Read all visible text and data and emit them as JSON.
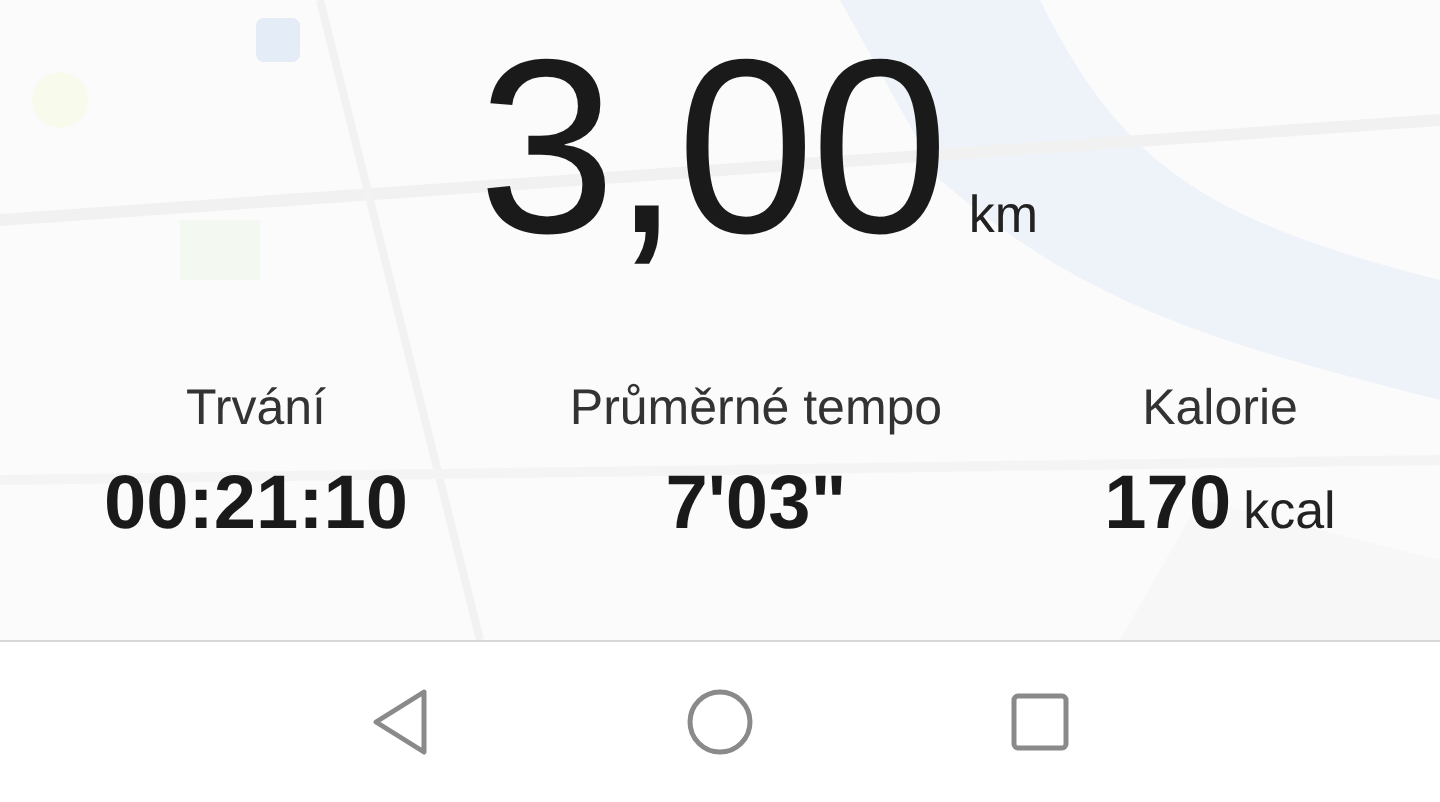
{
  "distance": {
    "value": "3,00",
    "unit": "km"
  },
  "stats": [
    {
      "label": "Trvání",
      "value": "00:21:10"
    },
    {
      "label": "Průměrné tempo",
      "value": "7'03\""
    },
    {
      "label": "Kalorie",
      "value": "170",
      "unit": "kcal"
    }
  ]
}
